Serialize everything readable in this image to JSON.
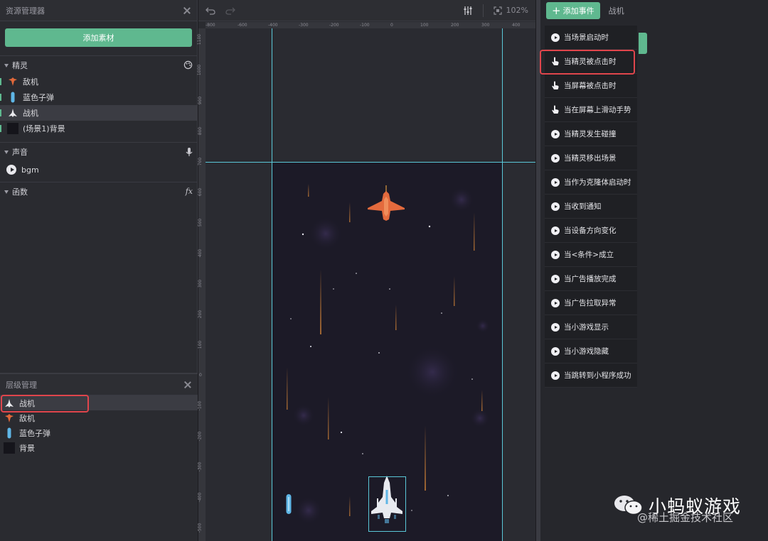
{
  "asset_manager": {
    "title": "资源管理器",
    "add_button": "添加素材",
    "sprites_section": "精灵",
    "sprites": [
      {
        "name": "敌机",
        "selected": false
      },
      {
        "name": "蓝色子弹",
        "selected": false
      },
      {
        "name": "战机",
        "selected": true
      },
      {
        "name": "(场景1)背景",
        "selected": false
      }
    ],
    "sound_section": "声音",
    "sounds": [
      {
        "name": "bgm"
      }
    ],
    "function_section": "函数",
    "function_icon": "fx"
  },
  "layers": {
    "title": "层级管理",
    "items": [
      {
        "name": "战机",
        "selected": true
      },
      {
        "name": "敌机",
        "selected": false
      },
      {
        "name": "蓝色子弹",
        "selected": false
      },
      {
        "name": "背景",
        "selected": false
      }
    ]
  },
  "toolbar": {
    "zoom": "102%"
  },
  "ruler": {
    "h_ticks": [
      "-800",
      "-600",
      "-400",
      "-300",
      "-200",
      "-100",
      "0",
      "100",
      "200",
      "300",
      "400"
    ],
    "v_ticks": [
      "1100",
      "1000",
      "900",
      "800",
      "700",
      "600",
      "500",
      "400",
      "300",
      "200",
      "100",
      "0",
      "-100",
      "-200",
      "-300",
      "-400",
      "-500"
    ]
  },
  "events": {
    "add_button": "添加事件",
    "target": "战机",
    "menu": [
      {
        "label": "当场景启动时",
        "icon": "play-icon"
      },
      {
        "label": "当精灵被点击时",
        "icon": "hand-icon",
        "highlighted": true
      },
      {
        "label": "当屏幕被点击时",
        "icon": "hand-icon"
      },
      {
        "label": "当在屏幕上滑动手势",
        "icon": "hand-icon"
      },
      {
        "label": "当精灵发生碰撞",
        "icon": "play-icon"
      },
      {
        "label": "当精灵移出场景",
        "icon": "play-icon"
      },
      {
        "label": "当作为克隆体启动时",
        "icon": "play-icon"
      },
      {
        "label": "当收到通知",
        "icon": "play-icon"
      },
      {
        "label": "当设备方向变化",
        "icon": "play-icon"
      },
      {
        "label": "当<条件>成立",
        "icon": "play-icon"
      },
      {
        "label": "当广告播放完成",
        "icon": "play-icon"
      },
      {
        "label": "当广告拉取异常",
        "icon": "play-icon"
      },
      {
        "label": "当小游戏显示",
        "icon": "play-icon"
      },
      {
        "label": "当小游戏隐藏",
        "icon": "play-icon"
      },
      {
        "label": "当跳转到小程序成功",
        "icon": "play-icon"
      }
    ]
  },
  "watermark": {
    "main": "小蚂蚁游戏",
    "sub": "@稀土掘金技术社区"
  },
  "colors": {
    "accent": "#5fb88f",
    "highlight": "#e0454c",
    "guide": "#5ac8d8"
  }
}
